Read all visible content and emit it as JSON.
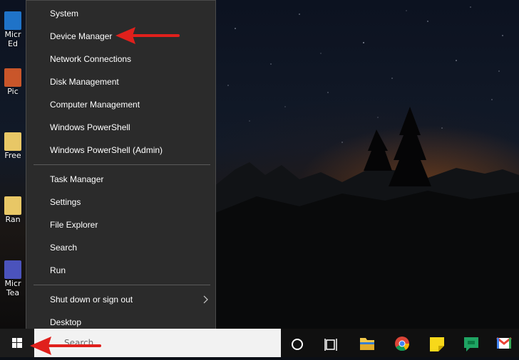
{
  "desktop": {
    "icons": [
      {
        "name": "Microsoft Edge",
        "label": "Micr\nEd",
        "icon": "edge-icon"
      },
      {
        "name": "Picasa",
        "label": "Pic",
        "icon": "picture-app-icon"
      },
      {
        "name": "Free",
        "label": "Free",
        "icon": "folder-icon"
      },
      {
        "name": "Ran",
        "label": "Ran",
        "icon": "folder-icon"
      },
      {
        "name": "Microsoft Teams",
        "label": "Micr\nTea",
        "icon": "teams-icon"
      }
    ]
  },
  "context_menu": {
    "group1": [
      "System",
      "Device Manager",
      "Network Connections",
      "Disk Management",
      "Computer Management",
      "Windows PowerShell",
      "Windows PowerShell (Admin)"
    ],
    "group2": [
      "Task Manager",
      "Settings",
      "File Explorer",
      "Search",
      "Run"
    ],
    "group3": [
      "Shut down or sign out",
      "Desktop"
    ]
  },
  "taskbar": {
    "search_placeholder": "Search",
    "icons": [
      "windows-start-icon",
      "cortana-circle-icon",
      "task-view-icon",
      "file-explorer-icon",
      "chrome-icon",
      "sticky-notes-icon",
      "hangouts-chat-icon",
      "gmail-icon"
    ]
  },
  "colors": {
    "menu_bg": "#2b2b2b",
    "taskbar_bg": "#101010",
    "annotation_arrow": "#e0201c"
  }
}
